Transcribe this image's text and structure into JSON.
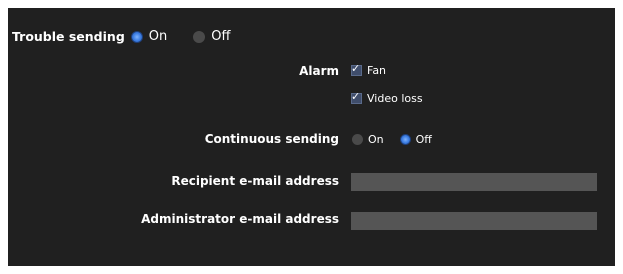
{
  "trouble_sending": {
    "label": "Trouble sending",
    "on_label": "On",
    "off_label": "Off",
    "selected": "On"
  },
  "alarm": {
    "label": "Alarm",
    "options": [
      {
        "label": "Fan",
        "checked": true
      },
      {
        "label": "Video loss",
        "checked": true
      }
    ]
  },
  "continuous_sending": {
    "label": "Continuous sending",
    "on_label": "On",
    "off_label": "Off",
    "selected": "Off"
  },
  "recipient": {
    "label": "Recipient e-mail address",
    "value": ""
  },
  "administrator": {
    "label": "Administrator e-mail address",
    "value": ""
  },
  "colors": {
    "panel_bg": "#202020",
    "selected_radio": "#3a7be0",
    "input_bg": "#555555"
  }
}
